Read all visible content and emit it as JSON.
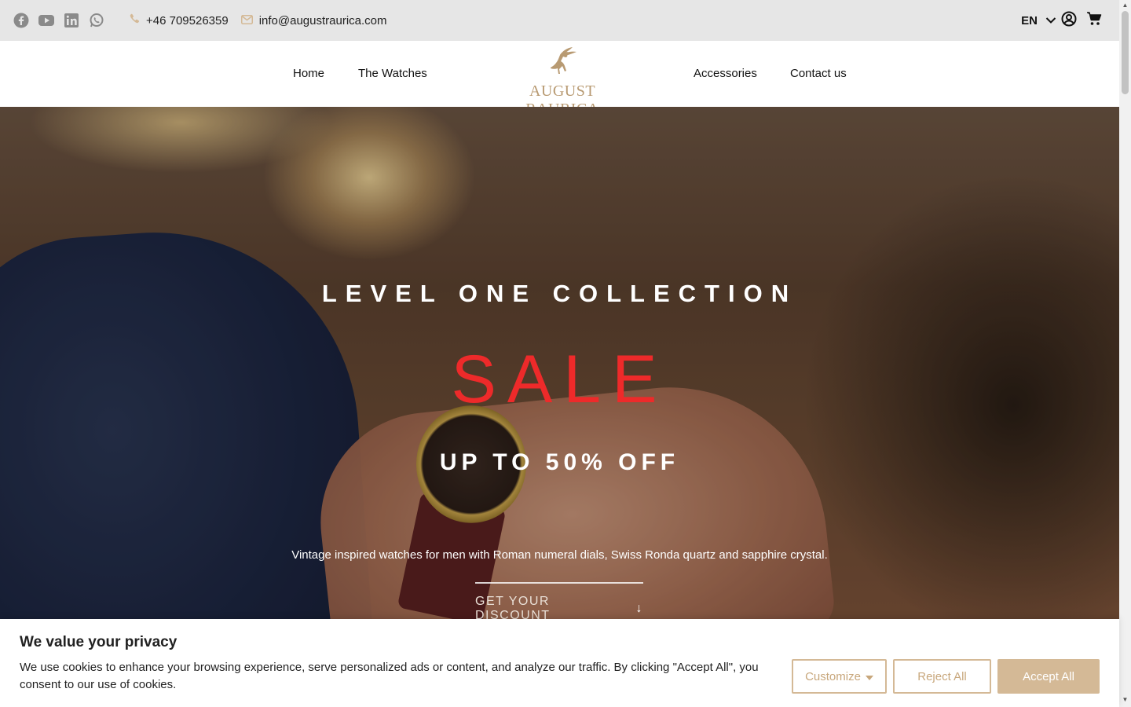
{
  "topbar": {
    "social_icons": [
      "facebook-icon",
      "youtube-icon",
      "linkedin-icon",
      "whatsapp-icon"
    ],
    "phone": "+46 709526359",
    "email": "info@augustraurica.com",
    "language": "EN"
  },
  "nav": {
    "items": [
      "Home",
      "The Watches",
      "Accessories",
      "Contact us"
    ],
    "logo_text": "AUGUST RAURICA"
  },
  "hero": {
    "heading": "LEVEL ONE COLLECTION",
    "sale": "SALE",
    "discount": "UP TO 50% OFF",
    "description": "Vintage inspired watches for men with Roman numeral dials, Swiss Ronda quartz and sapphire crystal.",
    "cta": "GET YOUR DISCOUNT",
    "cta_arrow": "↓"
  },
  "cookie": {
    "title": "We value your privacy",
    "text": "We use cookies to enhance your browsing experience, serve personalized ads or content, and analyze our traffic. By clicking \"Accept All\", you consent to our use of cookies.",
    "customize": "Customize",
    "reject": "Reject All",
    "accept": "Accept All"
  },
  "colors": {
    "accent": "#d4b996",
    "sale_red": "#ee2a2a",
    "logo_gold": "#b89a72"
  }
}
